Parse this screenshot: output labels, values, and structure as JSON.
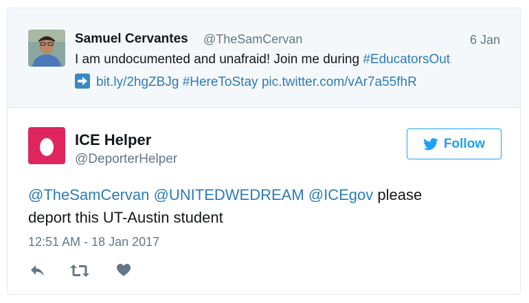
{
  "quoted_tweet": {
    "author_name": "Samuel Cervantes",
    "handle": "@TheSamCervan",
    "date": "6 Jan",
    "line1_text": "I am undocumented and unafraid! Join me during ",
    "line1_hashtag": "#EducatorsOut",
    "link_url": "bit.ly/2hgZBJg",
    "hashtag2": "#HereToStay",
    "pic_link": "pic.twitter.com/vAr7a55fhR"
  },
  "tweet": {
    "author_name": "ICE Helper",
    "handle": "@DeporterHelper",
    "follow_label": "Follow",
    "mention1": "@TheSamCervan",
    "mention2": "@UNITEDWEDREAM",
    "mention3": "@ICEgov",
    "text_line1_rest": " please",
    "text_line2": "deport this UT-Austin student",
    "timestamp": "12:51 AM - 18 Jan 2017"
  },
  "colors": {
    "link": "#2b7bb9",
    "follow_blue": "#1da1f2",
    "egg_avatar": "#e0245e",
    "muted": "#657786",
    "icon_gray": "#657786"
  },
  "icons": [
    "right-arrow-emoji-icon",
    "twitter-bird-icon",
    "reply-icon",
    "retweet-icon",
    "heart-icon"
  ]
}
